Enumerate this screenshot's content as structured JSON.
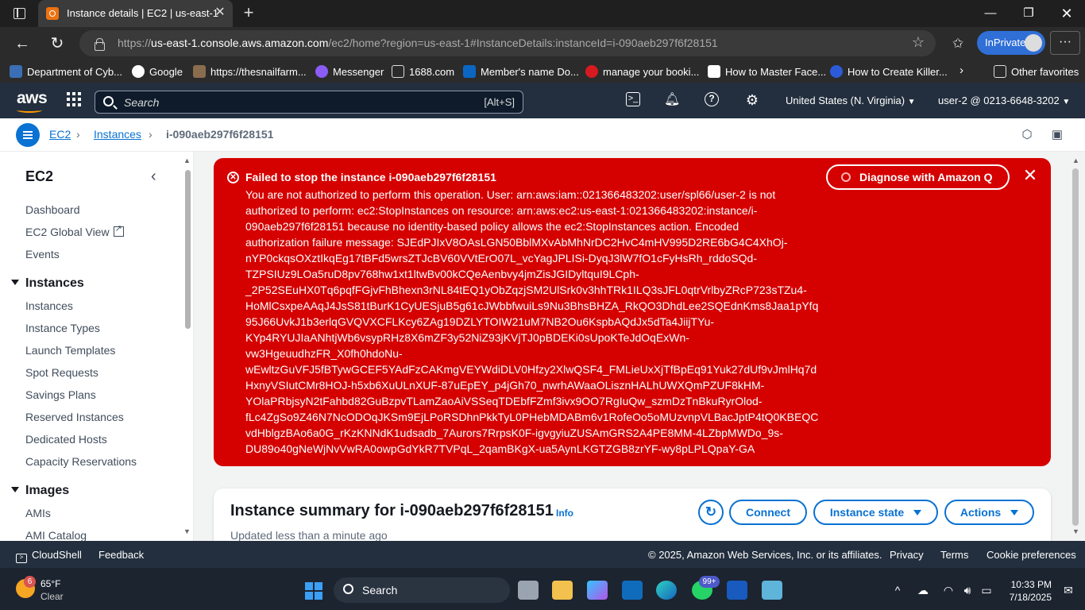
{
  "browser": {
    "tab_title": "Instance details | EC2 | us-east-1",
    "url_prefix": "https://",
    "url_host": "us-east-1.console.aws.amazon.com",
    "url_path": "/ec2/home?region=us-east-1#InstanceDetails:instanceId=i-090aeb297f6f28151",
    "inprivate_label": "InPrivate",
    "bookmarks": [
      {
        "label": "Department of Cyb...",
        "color": "#3b6fb5"
      },
      {
        "label": "Google",
        "color": "#ffffff"
      },
      {
        "label": "https://thesnailfarm...",
        "color": "#8a6d4e"
      },
      {
        "label": "Messenger",
        "color": "#8b5cf6"
      },
      {
        "label": "1688.com",
        "color": "#2b2b2b"
      },
      {
        "label": "Member's name Do...",
        "color": "#0a66c2"
      },
      {
        "label": "manage your booki...",
        "color": "#d71920"
      },
      {
        "label": "How to Master Face...",
        "color": "#ffffff"
      },
      {
        "label": "How to Create Killer...",
        "color": "#2d5bd8"
      }
    ],
    "other_favorites": "Other favorites"
  },
  "aws_header": {
    "logo_text": "aws",
    "search_placeholder": "Search",
    "search_shortcut": "[Alt+S]",
    "region": "United States (N. Virginia)",
    "account": "user-2 @ 0213-6648-3202"
  },
  "breadcrumb": {
    "service": "EC2",
    "section": "Instances",
    "current": "i-090aeb297f6f28151"
  },
  "sidenav": {
    "title": "EC2",
    "top_items": [
      "Dashboard",
      "EC2 Global View",
      "Events"
    ],
    "instances_section": "Instances",
    "instances_items": [
      "Instances",
      "Instance Types",
      "Launch Templates",
      "Spot Requests",
      "Savings Plans",
      "Reserved Instances",
      "Dedicated Hosts",
      "Capacity Reservations"
    ],
    "images_section": "Images",
    "images_items": [
      "AMIs",
      "AMI Catalog"
    ]
  },
  "flash": {
    "title": "Failed to stop the instance i-090aeb297f6f28151",
    "diagnose_label": "Diagnose with Amazon Q",
    "lines": [
      "You are not authorized to perform this operation. User: arn:aws:iam::021366483202:user/spl66/user-2 is not",
      "authorized to perform: ec2:StopInstances on resource: arn:aws:ec2:us-east-1:021366483202:instance/i-",
      "090aeb297f6f28151 because no identity-based policy allows the ec2:StopInstances action. Encoded",
      "authorization failure message: SJEdPJIxV8OAsLGN50BblMXvAbMhNrDC2HvC4mHV995D2RE6bG4C4XhOj-",
      "nYP0ckqsOXztIkqEg17tBFd5wrsZTJcBV60VVtErO07L_vcYagJPLISi-DyqJ3lW7fO1cFyHsRh_rddoSQd-",
      "TZPSIUz9LOa5ruD8pv768hw1xt1ltwBv00kCQeAenbvy4jmZisJGIDyltquI9LCph-",
      "_2P52SEuHX0Tq6pqfFGjvFhBhexn3rNL84tEQ1yObZqzjSM2UlSrk0v3hhTRk1ILQ3sJFL0qtrVrlbyZRcP723sTZu4-",
      "HoMlCsxpeAAqJ4JsS81tBurK1CyUESjuB5g61cJWbbfwuiLs9Nu3BhsBHZA_RkQO3DhdLee2SQEdnKms8Jaa1pYfq",
      "95J66UvkJ1b3erlqGVQVXCFLKcy6ZAg19DZLYTOIW21uM7NB2Ou6KspbAQdJx5dTa4JiijTYu-",
      "KYp4RYUJIaANhtjWb6vsypRHz8X6mZF3y52NiZ93jKVjTJ0pBDEKi0sUpoKTeJdOqExWn-",
      "vw3HgeuudhzFR_X0fh0hdoNu-",
      "wEwltzGuVFJ5fBTywGCEF5YAdFzCAKmgVEYWdiDLV0Hfzy2XlwQSF4_FMLieUxXjTfBpEq91Yuk27dUf9vJmlHq7d",
      "HxnyVSIutCMr8HOJ-h5xb6XuULnXUF-87uEpEY_p4jGh70_nwrhAWaaOLisznHALhUWXQmPZUF8kHM-",
      "YOlaPRbjsyN2tFahbd82GuBzpvTLamZaoAiVSSeqTDEbfFZmf3ivx9OO7RgIuQw_szmDzTnBkuRyrOlod-",
      "fLc4ZgSo9Z46N7NcODOqJKSm9EjLPoRSDhnPkkTyL0PHebMDABm6v1RofeOo5oMUzvnpVLBacJptP4tQ0KBEQC",
      "vdHblgzBAo6a0G_rKzKNNdK1udsadb_7Aurors7RrpsK0F-igvgyiuZUSAmGRS2A4PE8MM-4LZbpMWDo_9s-",
      "DU89o40gNeWjNvVwRA0owpGdYkR7TVPqL_2qamBKgX-ua5AynLKGTZGB8zrYF-wy8pLPLQpaY-GA"
    ]
  },
  "summary": {
    "title": "Instance summary for i-090aeb297f6f28151",
    "info": "Info",
    "updated": "Updated less than a minute ago",
    "connect_label": "Connect",
    "instance_state_label": "Instance state",
    "actions_label": "Actions"
  },
  "footer": {
    "cloudshell": "CloudShell",
    "feedback": "Feedback",
    "copyright": "© 2025, Amazon Web Services, Inc. or its affiliates.",
    "privacy": "Privacy",
    "terms": "Terms",
    "cookie": "Cookie preferences"
  },
  "taskbar": {
    "weather_badge": "6",
    "temperature": "65°F",
    "condition": "Clear",
    "search_label": "Search",
    "whatsapp_badge": "99+",
    "time": "10:33 PM",
    "date": "7/18/2025"
  },
  "colors": {
    "aws_header": "#232f3e",
    "aws_orange": "#ff9900",
    "error_red": "#d50000",
    "link_blue": "#0972d3"
  }
}
